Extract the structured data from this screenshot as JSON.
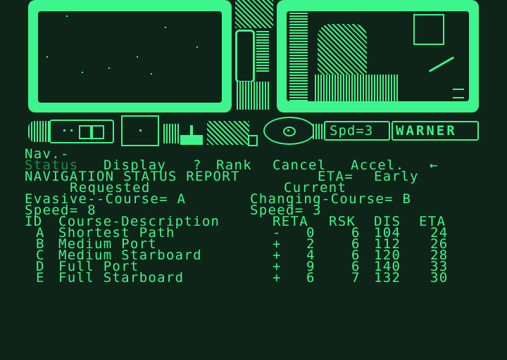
{
  "hud": {
    "speed_readout": "Spd=3",
    "warner": "WARNER"
  },
  "menu": {
    "prompt": "Nav.-",
    "items": [
      "Status",
      "Display",
      "?",
      "Rank",
      "Cancel",
      "Accel."
    ],
    "arrow": "←"
  },
  "report": {
    "title": "NAVIGATION STATUS REPORT",
    "eta_label": "ETA=",
    "eta_value": "Early",
    "requested_label": "Requested",
    "current_label": "Current",
    "requested_course": "Evasive--Course= A",
    "current_course": "Changing-Course= B",
    "requested_speed": "Speed= 8",
    "current_speed": "Speed= 3",
    "columns": [
      "ID",
      "Course-Description",
      "RETA",
      "RSK",
      "DIS",
      "ETA"
    ],
    "rows": [
      {
        "id": "A",
        "desc": "Shortest Path",
        "reta": "-",
        "reta_val": "0",
        "rsk": "6",
        "dis": "104",
        "eta": "24"
      },
      {
        "id": "B",
        "desc": "Medium Port",
        "reta": "+",
        "reta_val": "2",
        "rsk": "6",
        "dis": "112",
        "eta": "26"
      },
      {
        "id": "C",
        "desc": "Medium Starboard",
        "reta": "+",
        "reta_val": "4",
        "rsk": "6",
        "dis": "120",
        "eta": "28"
      },
      {
        "id": "D",
        "desc": "Full Port",
        "reta": "+",
        "reta_val": "9",
        "rsk": "6",
        "dis": "140",
        "eta": "33"
      },
      {
        "id": "E",
        "desc": "Full Starboard",
        "reta": "+",
        "reta_val": "6",
        "rsk": "7",
        "dis": "132",
        "eta": "30"
      }
    ]
  },
  "colors": {
    "phosphor": "#3cf58c",
    "background": "#0f2418",
    "dim": "#1e8a4f"
  }
}
